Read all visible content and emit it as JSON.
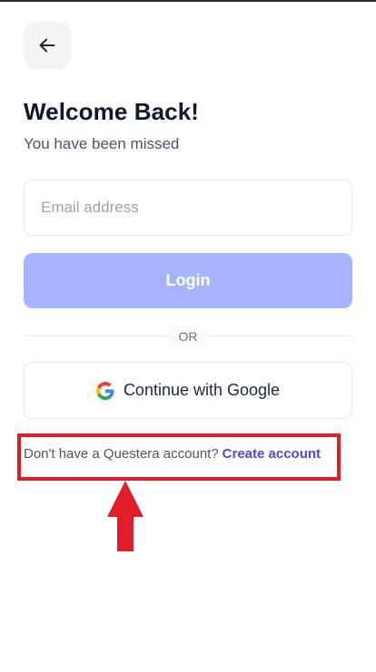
{
  "header": {
    "back_icon": "arrow-left-icon",
    "title": "Welcome Back!",
    "subtitle": "You have been missed"
  },
  "form": {
    "email_placeholder": "Email address",
    "email_value": "",
    "login_label": "Login",
    "divider_label": "OR",
    "google_label": "Continue with Google",
    "google_icon": "google-icon"
  },
  "footer": {
    "prompt": "Don't have a Questera account?",
    "link_label": "Create account"
  },
  "annotation": {
    "highlight_color": "#e11d2a",
    "arrow_icon": "up-arrow-icon"
  },
  "colors": {
    "accent": "#4f46e5",
    "login_button": "#a5b4fc"
  }
}
